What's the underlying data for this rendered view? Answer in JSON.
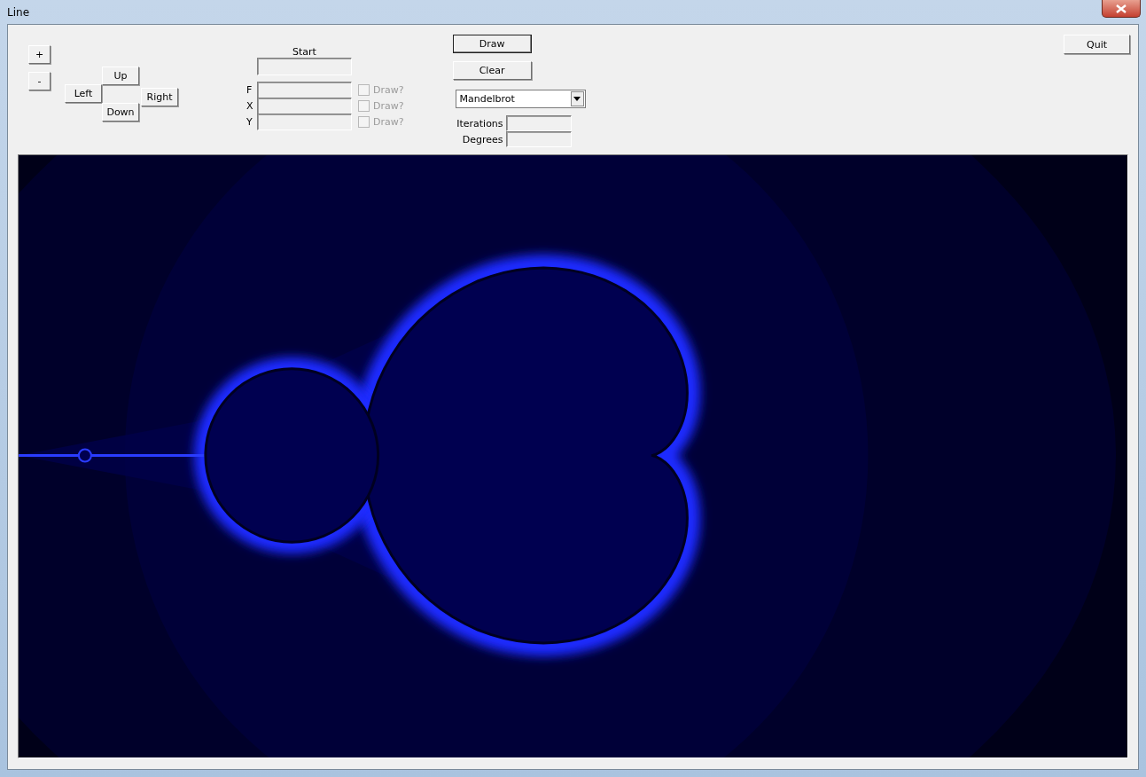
{
  "window": {
    "title": "Line"
  },
  "zoom_buttons": [
    "+",
    "-"
  ],
  "direction_buttons": {
    "up": "Up",
    "left": "Left",
    "right": "Right",
    "down": "Down"
  },
  "start": {
    "label": "Start"
  },
  "coordinates": [
    {
      "label": "F",
      "draw_label": "Draw?",
      "checked": false,
      "disabled": true
    },
    {
      "label": "X",
      "draw_label": "Draw?",
      "checked": false,
      "disabled": true
    },
    {
      "label": "Y",
      "draw_label": "Draw?",
      "checked": false,
      "disabled": true
    }
  ],
  "action_buttons": [
    {
      "label": "Draw",
      "default": true
    },
    {
      "label": "Clear",
      "default": false
    }
  ],
  "fractal_select": {
    "value": "Mandelbrot"
  },
  "parameters": [
    {
      "label": "Iterations"
    },
    {
      "label": "Degrees"
    }
  ],
  "quit_button": "Quit"
}
